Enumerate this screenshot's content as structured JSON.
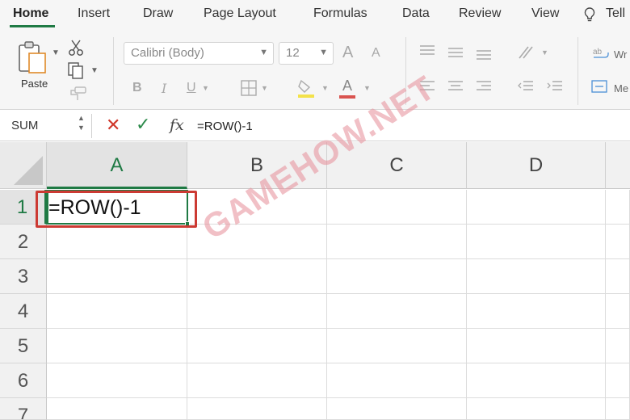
{
  "tabs": [
    "Home",
    "Insert",
    "Draw",
    "Page Layout",
    "Formulas",
    "Data",
    "Review",
    "View",
    "Tell"
  ],
  "ribbon": {
    "paste_label": "Paste",
    "font_name": "Calibri (Body)",
    "font_size": "12",
    "font_grow": "A",
    "font_shrink": "A",
    "bold": "B",
    "italic": "I",
    "underline": "U",
    "font_color": "A",
    "wrap_label": "Wr",
    "merge_label": "Me"
  },
  "formula_bar": {
    "name_box": "SUM",
    "fx": "fx",
    "formula": "=ROW()-1"
  },
  "grid": {
    "columns": [
      "A",
      "B",
      "C",
      "D"
    ],
    "rows": [
      "1",
      "2",
      "3",
      "4",
      "5",
      "6",
      "7"
    ],
    "active_cell": "A1",
    "active_cell_text": "=ROW()-1"
  },
  "watermark": "GAMEHOW.NET",
  "colors": {
    "accent_green": "#1f7a44",
    "cancel_red": "#d0372a",
    "highlight_red": "#cc3a33"
  }
}
